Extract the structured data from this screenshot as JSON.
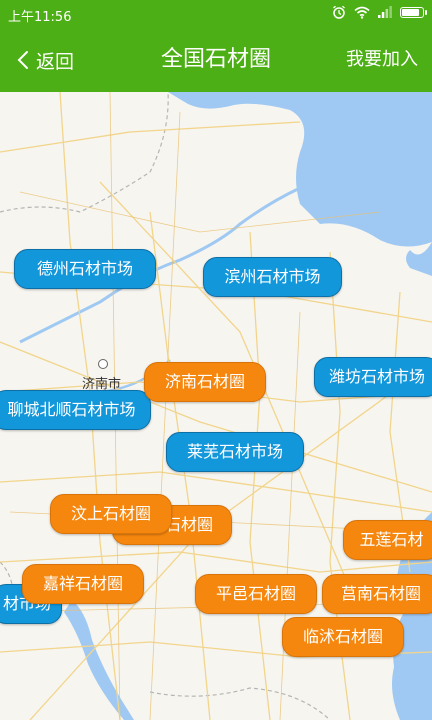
{
  "status_bar": {
    "time": "上午11:56",
    "battery_level": 0.9
  },
  "nav": {
    "back_label": "返回",
    "title": "全国石材圈",
    "join_label": "我要加入"
  },
  "colors": {
    "header": "#4caf15",
    "market_marker": "#1397db",
    "circle_marker": "#f6870e",
    "sea": "#9fc9f2"
  },
  "map": {
    "city_label": "济南市",
    "markers": [
      {
        "label": "德州石材市场",
        "type": "market"
      },
      {
        "label": "滨州石材市场",
        "type": "market"
      },
      {
        "label": "潍坊石材市场",
        "type": "market"
      },
      {
        "label": "聊城北顺石材市场",
        "type": "market"
      },
      {
        "label": "莱芜石材市场",
        "type": "market"
      },
      {
        "label": "材市场",
        "type": "market"
      },
      {
        "label": "济南石材圈",
        "type": "circle"
      },
      {
        "label": "石材圈",
        "type": "circle"
      },
      {
        "label": "汶上石材圈",
        "type": "circle"
      },
      {
        "label": "五莲石材",
        "type": "circle"
      },
      {
        "label": "嘉祥石材圈",
        "type": "circle"
      },
      {
        "label": "平邑石材圈",
        "type": "circle"
      },
      {
        "label": "莒南石材圈",
        "type": "circle"
      },
      {
        "label": "临沭石材圈",
        "type": "circle"
      }
    ]
  }
}
